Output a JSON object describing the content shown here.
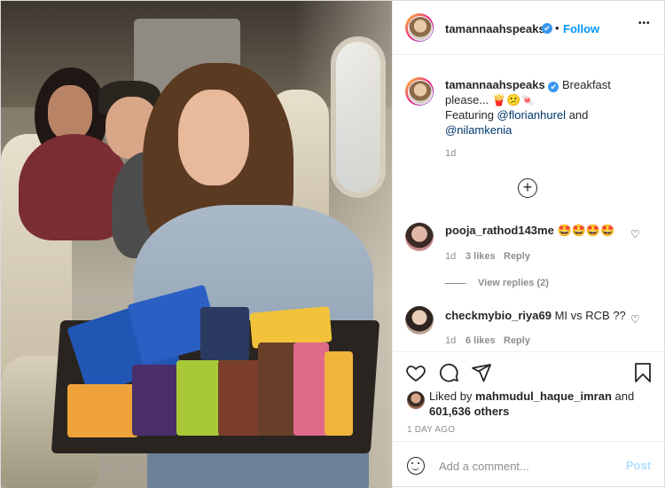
{
  "post": {
    "username": "tamannaahspeaks",
    "verified_mark": "✔",
    "separator": "•",
    "follow_label": "Follow",
    "more_label": "•••"
  },
  "caption": {
    "username": "tamannaahspeaks",
    "text_start": "Breakfast please...",
    "emojis": "🍟😕🍬",
    "featuring": "Featuring",
    "mention1": "@florianhurel",
    "and": "and",
    "mention2": "@nilamkenia",
    "time": "1d"
  },
  "load_more_label": "+",
  "comments": [
    {
      "username": "pooja_rathod143me",
      "text": "🤩🤩🤩🤩",
      "time": "1d",
      "likes": "3 likes",
      "reply": "Reply",
      "view_replies": "View replies (2)",
      "avatar_color": "#c98a8a"
    },
    {
      "username": "checkmybio_riya69",
      "text": "MI vs RCB ??",
      "time": "1d",
      "likes": "6 likes",
      "reply": "Reply",
      "avatar_color": "#b9a394"
    }
  ],
  "likes": {
    "liked_by": "Liked by",
    "liker": "mahmudul_haque_imran",
    "and": "and",
    "others": "601,636 others"
  },
  "timestamp": "1 DAY AGO",
  "comment_input": {
    "placeholder": "Add a comment...",
    "post_label": "Post"
  },
  "icons": {
    "heart": "heart-icon",
    "comment": "comment-icon",
    "share": "share-icon",
    "bookmark": "bookmark-icon",
    "smile": "emoji-icon",
    "more": "more-options-icon",
    "add": "load-more-comments-icon"
  },
  "colors": {
    "link": "#00376b",
    "follow": "#0095f6",
    "post_disabled": "#b2dffc",
    "muted": "#8e8e8e"
  }
}
